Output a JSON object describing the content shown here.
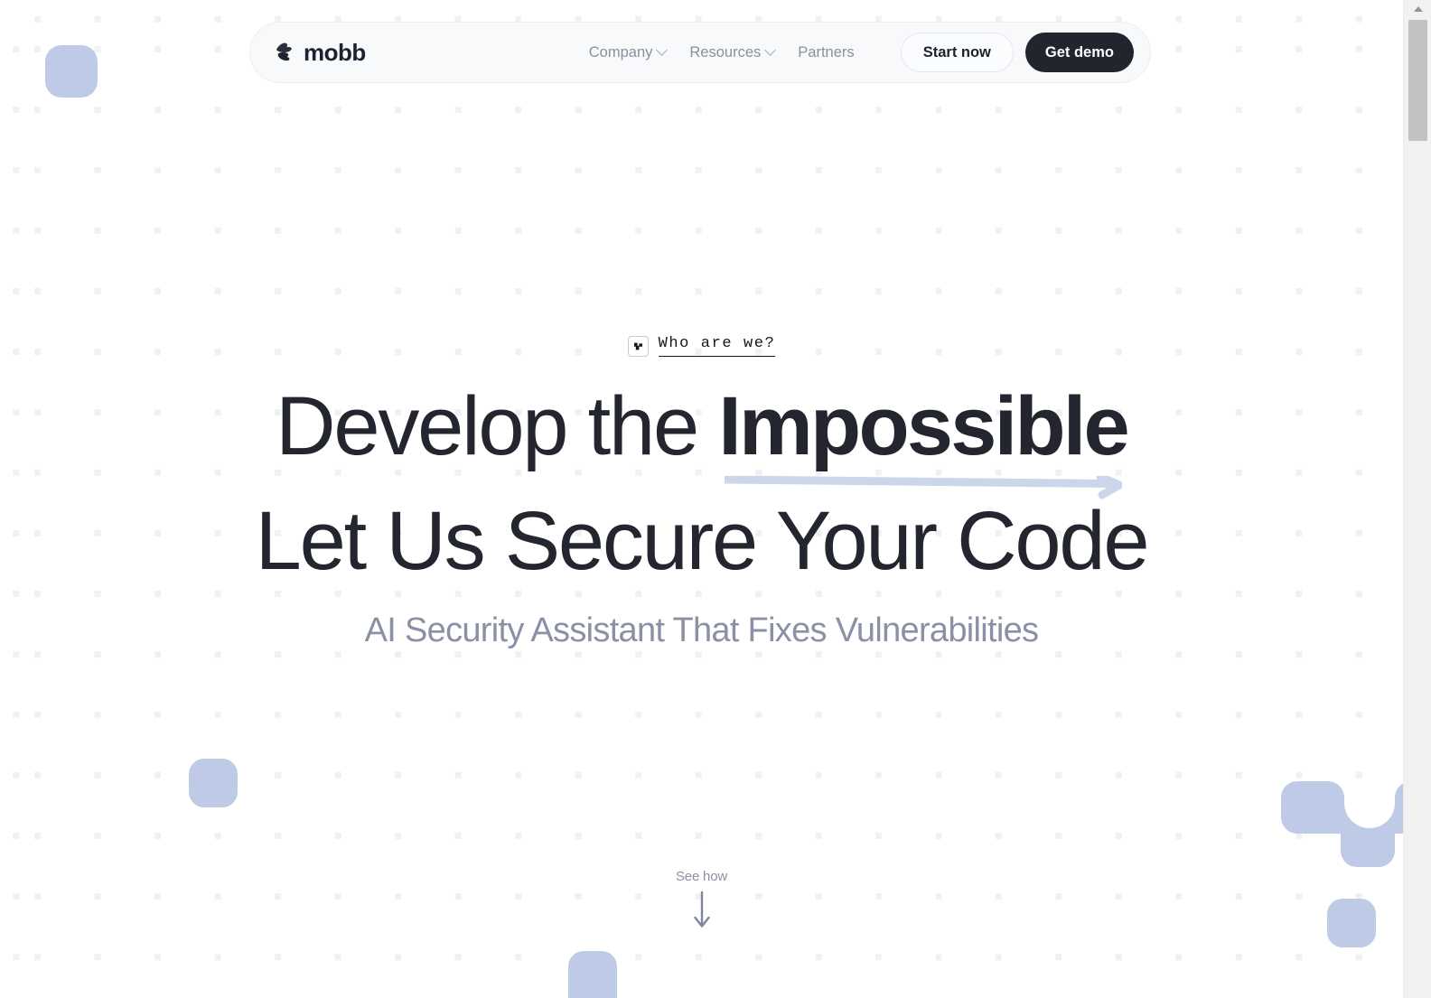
{
  "nav": {
    "brand": {
      "name": "mobb",
      "logo_icon": "mobb-bandit-logo-icon"
    },
    "links": [
      {
        "label": "Company",
        "has_dropdown": true,
        "icon": "chevron-down-icon"
      },
      {
        "label": "Resources",
        "has_dropdown": true,
        "icon": "chevron-down-icon"
      },
      {
        "label": "Partners",
        "has_dropdown": false,
        "icon": ""
      }
    ],
    "actions": {
      "secondary_label": "Start now",
      "primary_label": "Get demo"
    }
  },
  "hero": {
    "eyebrow": {
      "icon": "mobb-mark-icon",
      "label": "Who are we?"
    },
    "headline": {
      "line1_regular": "Develop the ",
      "line1_strong": "Impossible",
      "line2": "Let Us Secure Your Code",
      "underline_icon": "arrow-right-icon"
    },
    "subtitle": "AI Security Assistant That Fixes Vulnerabilities"
  },
  "see_how": {
    "label": "See how",
    "icon": "arrow-down-icon"
  },
  "scrollbar": {
    "up_icon": "scroll-up-arrow-icon",
    "thumb": "scroll-thumb"
  },
  "decor": {
    "blob_color": "#bfcae6",
    "grid_dot_color": "#f0f1f3",
    "shapes": [
      "rounded-square-top-left",
      "rounded-square-left",
      "rounded-square-bottom-center",
      "rounded-square-bottom-right",
      "y-merge-shape-right"
    ]
  },
  "colors": {
    "text_dark": "#23252f",
    "text_muted": "#8b90a6",
    "nav_link": "#8a8f9e",
    "button_dark_bg": "#22242e",
    "navbar_bg": "#f8f9fb",
    "accent_arrow": "#ccd6ea",
    "page_bg": "#ffffff"
  }
}
